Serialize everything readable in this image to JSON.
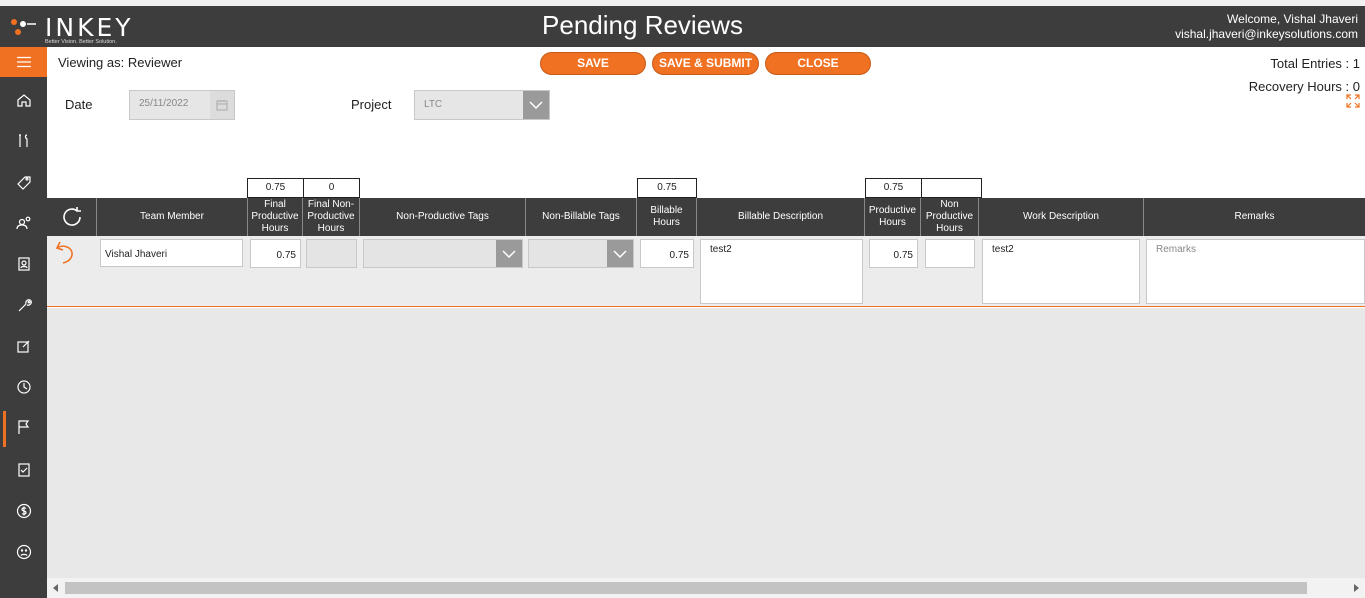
{
  "header": {
    "logo_text": "INKEY",
    "logo_tagline": "Better Vision. Better Solution.",
    "title": "Pending Reviews",
    "welcome": "Welcome, Vishal Jhaveri",
    "email": "vishal.jhaveri@inkeysolutions.com"
  },
  "sidebar": {
    "icons": [
      "menu-icon",
      "home-icon",
      "tools-icon",
      "tag-icon",
      "team-icon",
      "document-icon",
      "wrench-icon",
      "edit-icon",
      "clock-icon",
      "flag-icon",
      "checklist-icon",
      "dollar-icon",
      "sad-face-icon"
    ],
    "active": "flag-icon"
  },
  "toolbar": {
    "viewing_as": "Viewing as: Reviewer",
    "save_label": "SAVE",
    "save_submit_label": "SAVE & SUBMIT",
    "close_label": "CLOSE"
  },
  "summary": {
    "total_entries": "Total Entries : 1",
    "recovery_hours": "Recovery Hours : 0"
  },
  "filters": {
    "date_label": "Date",
    "date_value": "25/11/2022",
    "project_label": "Project",
    "project_value": "LTC"
  },
  "totals": {
    "final_productive": "0.75",
    "final_non_productive": "0",
    "billable": "0.75",
    "productive": "0.75",
    "non_productive": ""
  },
  "columns": {
    "team_member": "Team Member",
    "final_productive": "Final Productive Hours",
    "final_non_productive": "Final Non-Productive Hours",
    "non_productive_tags": "Non-Productive Tags",
    "non_billable_tags": "Non-Billable Tags",
    "billable_hours": "Billable Hours",
    "billable_description": "Billable Description",
    "productive_hours": "Productive Hours",
    "non_productive_hours": "Non Productive Hours",
    "work_description": "Work Description",
    "remarks": "Remarks"
  },
  "row": {
    "team_member": "Vishal Jhaveri",
    "final_productive": "0.75",
    "final_non_productive": "",
    "billable_hours": "0.75",
    "billable_description": "test2",
    "productive_hours": "0.75",
    "non_productive_hours": "",
    "work_description": "test2",
    "remarks_placeholder": "Remarks"
  },
  "colors": {
    "accent": "#f07122",
    "header_bg": "#3d3d3d",
    "grid_bg": "#ececec"
  }
}
